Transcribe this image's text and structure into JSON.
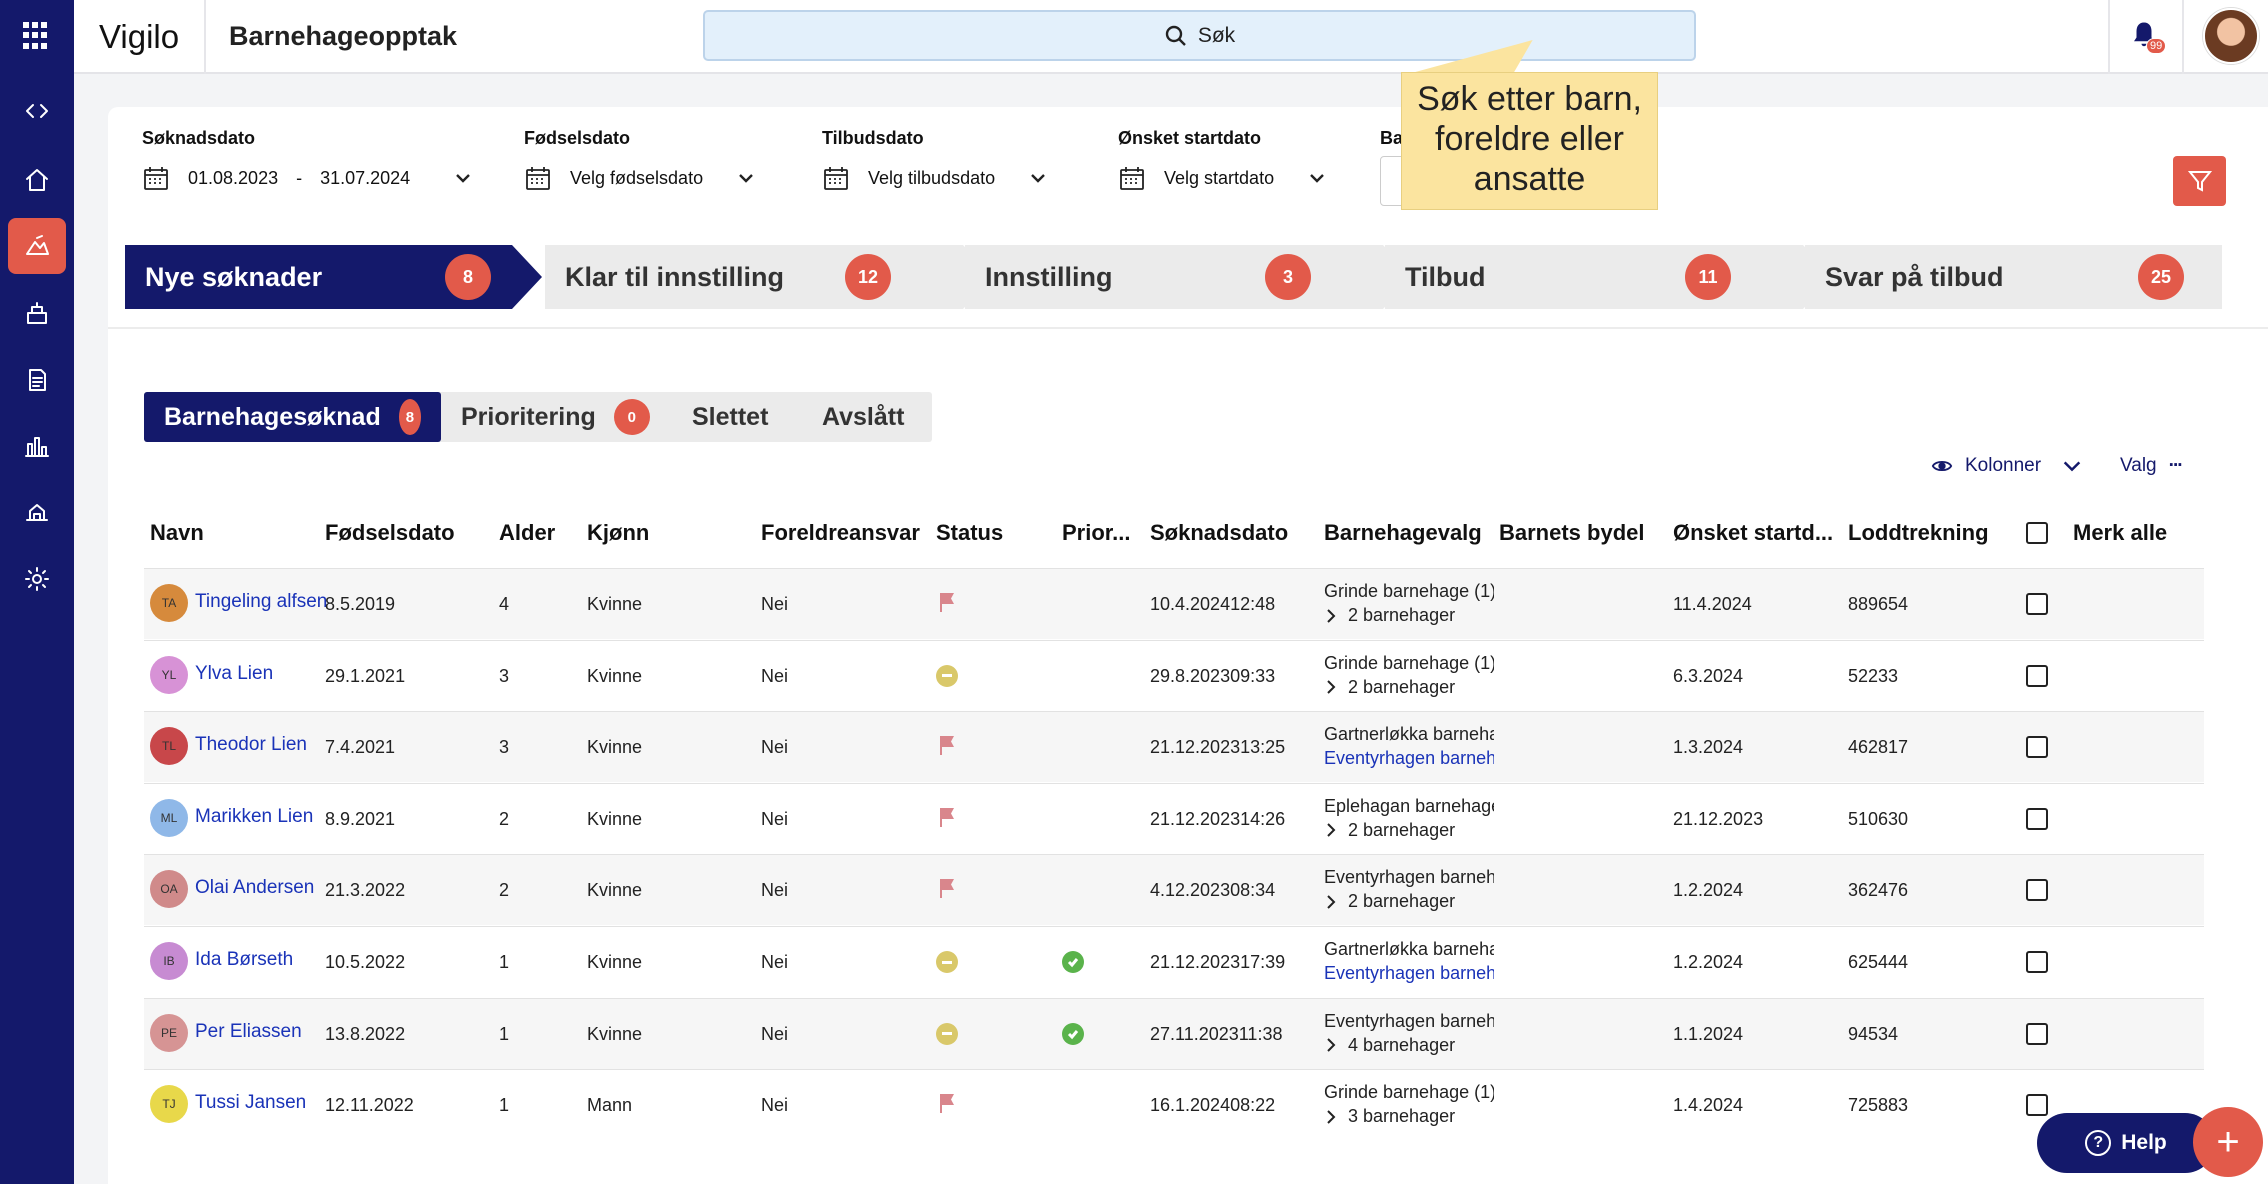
{
  "app": {
    "name": "Vigilo",
    "module": "Barnehageopptak"
  },
  "search": {
    "label": "Søk"
  },
  "tooltip": {
    "text": "Søk etter barn, foreldre eller ansatte"
  },
  "notifications": {
    "count": "99"
  },
  "filters": {
    "soknadsdato": {
      "label": "Søknadsdato",
      "from": "01.08.2023",
      "sep": "-",
      "to": "31.07.2024"
    },
    "fodselsdato": {
      "label": "Fødselsdato",
      "value": "Velg fødselsdato"
    },
    "tilbudsdato": {
      "label": "Tilbudsdato",
      "value": "Velg tilbudsdato"
    },
    "startdato": {
      "label": "Ønsket startdato",
      "value": "Velg startdato"
    },
    "truncated_label": "Ba"
  },
  "steps": [
    {
      "label": "Nye søknader",
      "count": "8"
    },
    {
      "label": "Klar til innstilling",
      "count": "12"
    },
    {
      "label": "Innstilling",
      "count": "3"
    },
    {
      "label": "Tilbud",
      "count": "11"
    },
    {
      "label": "Svar på tilbud",
      "count": "25"
    }
  ],
  "subtabs": [
    {
      "label": "Barnehagesøknad",
      "count": "8"
    },
    {
      "label": "Prioritering",
      "count": "0"
    },
    {
      "label": "Slettet"
    },
    {
      "label": "Avslått"
    }
  ],
  "tools": {
    "columns": "Kolonner",
    "options": "Valg",
    "options_icon": "···"
  },
  "columns": [
    "Navn",
    "Fødselsdato",
    "Alder",
    "Kjønn",
    "Foreldreansvar",
    "Status",
    "Prior...",
    "Søknadsdato",
    "Barnehagevalg",
    "Barnets bydel",
    "Ønsket startd...",
    "Loddtrekning",
    "Merk alle"
  ],
  "rows": [
    {
      "initials": "TA",
      "avatar_color": "#d68a3c",
      "name": "Tingeling alfsen",
      "dob": "8.5.2019",
      "age": "4",
      "gender": "Kvinne",
      "parental": "Nei",
      "status": "flag",
      "priority": "",
      "applied": "10.4.202412:48",
      "choice1": "Grinde barnehage (1) ·",
      "choice2": "2 barnehager",
      "choice2_link": false,
      "start": "11.4.2024",
      "lottery": "889654"
    },
    {
      "initials": "YL",
      "avatar_color": "#d792d6",
      "name": "Ylva Lien",
      "dob": "29.1.2021",
      "age": "3",
      "gender": "Kvinne",
      "parental": "Nei",
      "status": "pending",
      "priority": "",
      "applied": "29.8.202309:33",
      "choice1": "Grinde barnehage (1) ·",
      "choice2": "2 barnehager",
      "choice2_link": false,
      "start": "6.3.2024",
      "lottery": "52233"
    },
    {
      "initials": "TL",
      "avatar_color": "#c8474a",
      "name": "Theodor Lien",
      "dob": "7.4.2021",
      "age": "3",
      "gender": "Kvinne",
      "parental": "Nei",
      "status": "flag",
      "priority": "",
      "applied": "21.12.202313:25",
      "choice1": "Gartnerløkka barneha",
      "choice2": "Eventyrhagen barneh",
      "choice2_link": true,
      "start": "1.3.2024",
      "lottery": "462817"
    },
    {
      "initials": "ML",
      "avatar_color": "#8fb8e8",
      "name": "Marikken Lien",
      "dob": "8.9.2021",
      "age": "2",
      "gender": "Kvinne",
      "parental": "Nei",
      "status": "flag",
      "priority": "",
      "applied": "21.12.202314:26",
      "choice1": "Eplehagan barnehage",
      "choice2": "2 barnehager",
      "choice2_link": false,
      "start": "21.12.2023",
      "lottery": "510630"
    },
    {
      "initials": "OA",
      "avatar_color": "#d08a8a",
      "name": "Olai Andersen",
      "dob": "21.3.2022",
      "age": "2",
      "gender": "Kvinne",
      "parental": "Nei",
      "status": "flag",
      "priority": "",
      "applied": "4.12.202308:34",
      "choice1": "Eventyrhagen barneh",
      "choice2": "2 barnehager",
      "choice2_link": false,
      "start": "1.2.2024",
      "lottery": "362476"
    },
    {
      "initials": "IB",
      "avatar_color": "#c78bd2",
      "name": "Ida Børseth",
      "dob": "10.5.2022",
      "age": "1",
      "gender": "Kvinne",
      "parental": "Nei",
      "status": "pending",
      "priority": "ok",
      "applied": "21.12.202317:39",
      "choice1": "Gartnerløkka barneha",
      "choice2": "Eventyrhagen barneh",
      "choice2_link": true,
      "start": "1.2.2024",
      "lottery": "625444"
    },
    {
      "initials": "PE",
      "avatar_color": "#d69494",
      "name": "Per Eliassen",
      "dob": "13.8.2022",
      "age": "1",
      "gender": "Kvinne",
      "parental": "Nei",
      "status": "pending",
      "priority": "ok",
      "applied": "27.11.202311:38",
      "choice1": "Eventyrhagen barneh",
      "choice2": "4 barnehager",
      "choice2_link": false,
      "start": "1.1.2024",
      "lottery": "94534"
    },
    {
      "initials": "TJ",
      "avatar_color": "#e8d84a",
      "name": "Tussi Jansen",
      "dob": "12.11.2022",
      "age": "1",
      "gender": "Mann",
      "parental": "Nei",
      "status": "flag",
      "priority": "",
      "applied": "16.1.202408:22",
      "choice1": "Grinde barnehage (1) ·",
      "choice2": "3 barnehager",
      "choice2_link": false,
      "start": "1.4.2024",
      "lottery": "725883"
    }
  ],
  "help": {
    "label": "Help",
    "icon": "?"
  },
  "fab": {
    "icon": "+"
  },
  "colors": {
    "navy": "#14196b",
    "accent": "#e25a4a",
    "link": "#1a33b8",
    "tooltip": "#fbe49f"
  }
}
